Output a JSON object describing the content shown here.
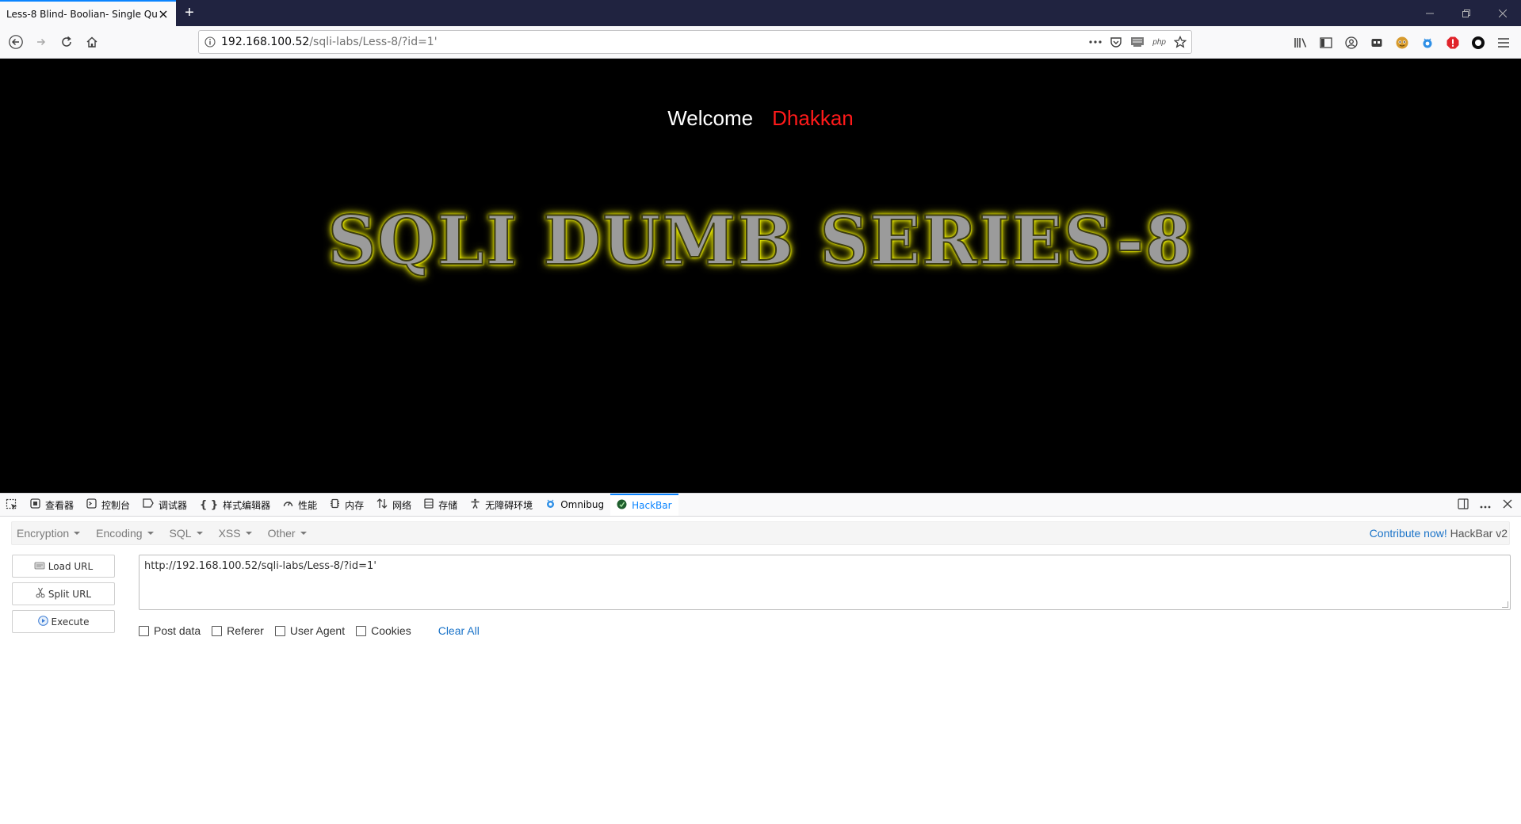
{
  "browser": {
    "tab_title": "Less-8 Blind- Boolian- Single Qu",
    "new_tab_symbol": "+",
    "url_host": "192.168.100.52",
    "url_path": "/sqli-labs/Less-8/?id=1'",
    "url_right_php": "php"
  },
  "page": {
    "welcome_label": "Welcome",
    "welcome_name": "Dhakkan",
    "banner": "SQLI DUMB SERIES-8",
    "colors": {
      "background": "#000000",
      "welcome": "#ffffff",
      "name": "#ff1a1a",
      "banner_glow": "#f5f500"
    }
  },
  "devtools": {
    "tabs": [
      {
        "icon": "inspector-icon",
        "label": "查看器"
      },
      {
        "icon": "console-icon",
        "label": "控制台"
      },
      {
        "icon": "debugger-icon",
        "label": "调试器"
      },
      {
        "icon": "style-editor-icon",
        "label": "样式编辑器"
      },
      {
        "icon": "performance-icon",
        "label": "性能"
      },
      {
        "icon": "memory-icon",
        "label": "内存"
      },
      {
        "icon": "network-icon",
        "label": "网络"
      },
      {
        "icon": "storage-icon",
        "label": "存储"
      },
      {
        "icon": "accessibility-icon",
        "label": "无障碍环境"
      },
      {
        "icon": "omnibug-icon",
        "label": "Omnibug"
      },
      {
        "icon": "hackbar-icon",
        "label": "HackBar"
      }
    ],
    "active_tab": "HackBar"
  },
  "hackbar": {
    "menu": [
      "Encryption",
      "Encoding",
      "SQL",
      "XSS",
      "Other"
    ],
    "contribute_label": "Contribute now!",
    "version_label": "HackBar v2",
    "load_url_label": "Load URL",
    "split_url_label": "Split URL",
    "execute_label": "Execute",
    "url_value": "http://192.168.100.52/sqli-labs/Less-8/?id=1'",
    "options": [
      "Post data",
      "Referer",
      "User Agent",
      "Cookies"
    ],
    "clear_all_label": "Clear All"
  }
}
